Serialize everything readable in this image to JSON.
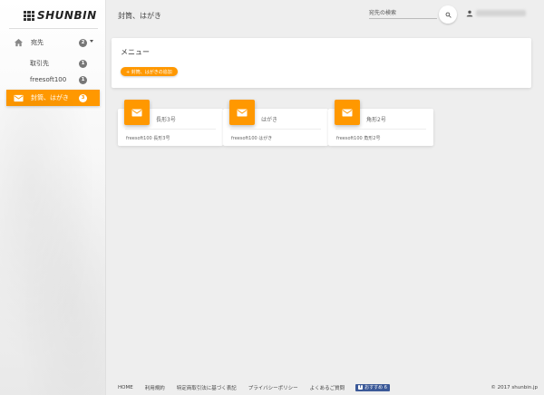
{
  "brand": {
    "logo_text": "SHUNBIN"
  },
  "header": {
    "title": "封筒、はがき",
    "search_placeholder": "宛先の検索",
    "user_name": ""
  },
  "sidebar": {
    "items": [
      {
        "label": "宛先",
        "count": "2",
        "icon": "home-icon"
      },
      {
        "label": "取引先",
        "count": "1"
      },
      {
        "label": "freesoft100",
        "count": "1"
      },
      {
        "label": "封筒、はがき",
        "count": "3",
        "icon": "mail-icon",
        "active": true
      }
    ]
  },
  "menu": {
    "title": "メニュー",
    "add_button": "+ 封筒、はがきの追加"
  },
  "cards": [
    {
      "title": "長形3号",
      "description": "freesoft100 長形3号",
      "icon": "envelope-icon"
    },
    {
      "title": "はがき",
      "description": "freesoft100 はがき",
      "icon": "envelope-icon"
    },
    {
      "title": "角形2号",
      "description": "freesoft100 角形2号",
      "icon": "envelope-icon"
    }
  ],
  "footer": {
    "links": [
      "HOME",
      "利用規約",
      "特定商取引法に基づく表記",
      "プライバシーポリシー",
      "よくあるご質問"
    ],
    "fb_label": "おすすめ 6",
    "copyright": "© 2017 shunbin.jp"
  },
  "colors": {
    "accent": "#ff9800",
    "badge": "#777777",
    "facebook": "#3b5998"
  }
}
